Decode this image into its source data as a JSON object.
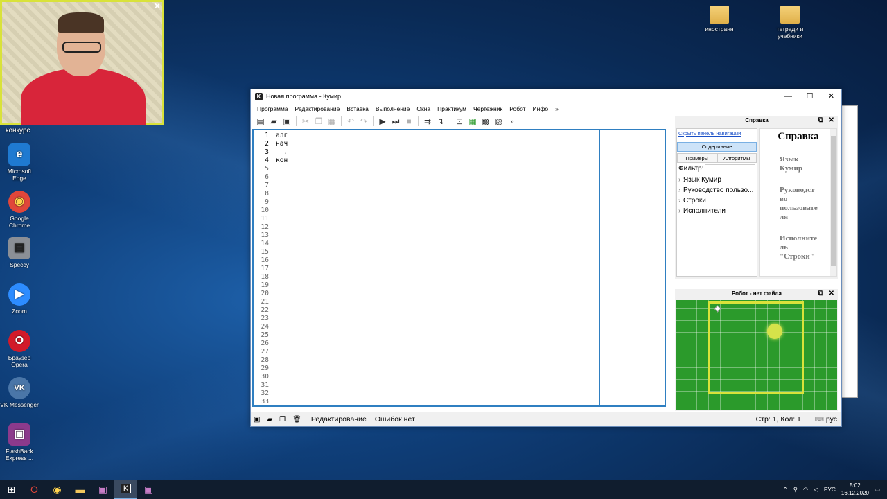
{
  "webcam": {
    "close_icon": "×",
    "caption": "конкурс"
  },
  "desktop_icons": [
    {
      "label": "Microsoft Edge",
      "icon": "edge-icon",
      "glyph": "e",
      "color": "#1f7ad1"
    },
    {
      "label": "Google Chrome",
      "icon": "chrome-icon",
      "glyph": "◉",
      "color": "#e0463a"
    },
    {
      "label": "Speccy",
      "icon": "speccy-icon",
      "glyph": "▤",
      "color": "#8b8f96"
    },
    {
      "label": "Zoom",
      "icon": "zoom-icon",
      "glyph": "▶",
      "color": "#2d8cff"
    },
    {
      "label": "Браузер Opera",
      "icon": "opera-icon",
      "glyph": "O",
      "color": "#d21a2a"
    },
    {
      "label": "VK Messenger",
      "icon": "vk-icon",
      "glyph": "VK",
      "color": "#4a76a8"
    },
    {
      "label": "FlashBack Express ...",
      "icon": "flashback-icon",
      "glyph": "▣",
      "color": "#8c3a8c"
    }
  ],
  "desktop_folders": [
    {
      "label": "иностранн"
    },
    {
      "label": "тетради и учебники"
    }
  ],
  "window": {
    "title": "Новая программа - Кумир",
    "app_icon": "K",
    "controls": {
      "minimize": "—",
      "maximize": "☐",
      "close": "✕"
    },
    "menu": [
      "Программа",
      "Редактирование",
      "Вставка",
      "Выполнение",
      "Окна",
      "Практикум",
      "Чертежник",
      "Робот",
      "Инфо",
      "»"
    ],
    "more_toolbar": "»"
  },
  "editor": {
    "line_numbers": [
      "1",
      "2",
      "3",
      "4",
      "5",
      "6",
      "7",
      "8",
      "9",
      "10",
      "11",
      "12",
      "13",
      "14",
      "15",
      "16",
      "17",
      "18",
      "19",
      "20",
      "21",
      "22",
      "23",
      "24",
      "25",
      "26",
      "27",
      "28",
      "29",
      "30",
      "31",
      "32",
      "33"
    ],
    "lines": [
      "алг",
      "нач",
      "  .",
      "кон"
    ]
  },
  "status": {
    "mode": "Редактирование",
    "errors": "Ошибок нет",
    "position": "Стр: 1, Кол: 1",
    "lang": "рус"
  },
  "help": {
    "panel_title": "Справка",
    "hide_nav_link": "Скрыть панель навигации",
    "tab_contents": "Содержание",
    "tab_examples": "Примеры",
    "tab_algorithms": "Алгоритмы",
    "filter_label": "Фильтр:",
    "tree": [
      "Язык Кумир",
      "Руководство пользо...",
      "Строки",
      "Исполнители"
    ],
    "content_title": "Справка",
    "content_items": [
      "Язык Кумир",
      "Руководство пользователя",
      "Исполнитель \"Строки\""
    ]
  },
  "robot": {
    "panel_title": "Робот - нет файла"
  },
  "taskbar": {
    "tray_lang": "РУС",
    "time": "5:02",
    "date": "16.12.2020"
  }
}
